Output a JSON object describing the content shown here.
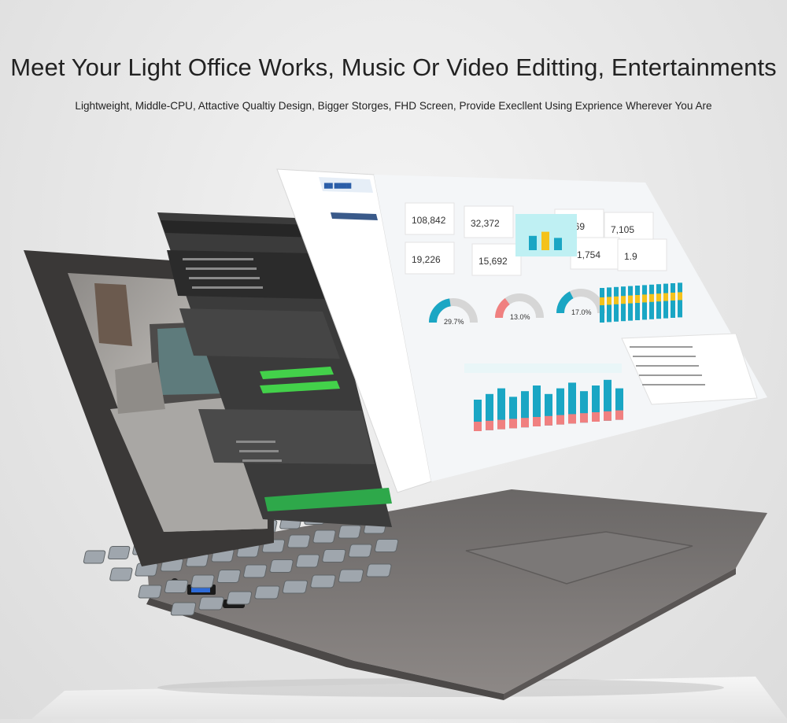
{
  "hero": {
    "headline": "Meet Your Light Office Works, Music Or Video Editting, Entertainments",
    "subheadline": "Lightweight, Middle-CPU, Attactive Qualtiy Design, Bigger Storges, FHD Screen, Provide Execllent Using Exprience Wherever You Are"
  },
  "colors": {
    "background": "#e7e7e7",
    "laptop_body": "#6f6c6b",
    "keyboard_keys": "#9fa6ad",
    "editor_panel": "#3d3d3d",
    "dashboard_accent": "#1aa6c4",
    "dashboard_yellow": "#f4c21b",
    "dashboard_red": "#f08080",
    "meter_green": "#43d14a"
  },
  "dashboard": {
    "kpis": [
      {
        "value": "108,842"
      },
      {
        "value": "32,372"
      },
      {
        "value": "8,769"
      },
      {
        "value": "7,105"
      },
      {
        "value": "19,226"
      },
      {
        "value": "15,692"
      },
      {
        "value": "1,754"
      },
      {
        "value": "1.9"
      }
    ],
    "gauges": [
      {
        "value": "29.7%",
        "level": 0.45
      },
      {
        "value": "13.0%",
        "level": 0.3
      },
      {
        "value": "17.0%",
        "level": 0.35
      }
    ]
  }
}
